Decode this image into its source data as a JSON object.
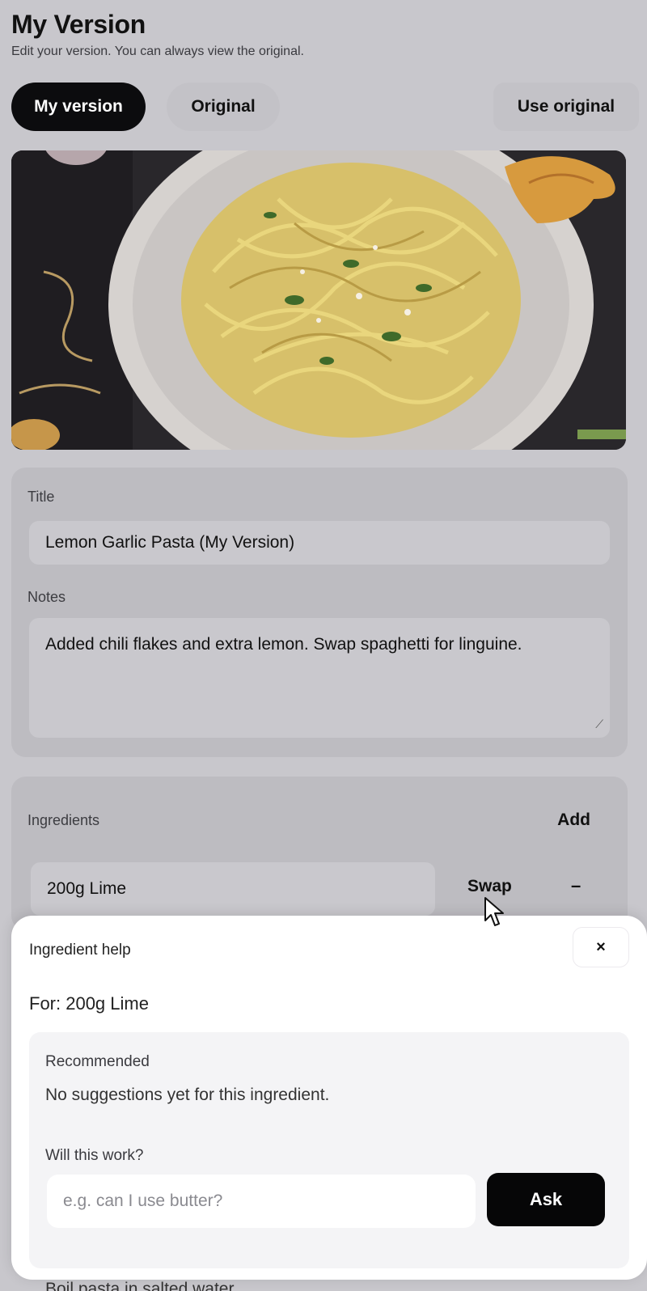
{
  "header": {
    "title": "My Version",
    "subtitle": "Edit your version. You can always view the original."
  },
  "tabs": {
    "my_version": "My version",
    "original": "Original",
    "use_original": "Use original",
    "active": "My version"
  },
  "hero": {
    "description_icon": "pasta-photo"
  },
  "form": {
    "title_label": "Title",
    "title_value": "Lemon Garlic Pasta (My Version)",
    "notes_label": "Notes",
    "notes_value": "Added chili flakes and extra lemon. Swap spaghetti for linguine."
  },
  "ingredients": {
    "label": "Ingredients",
    "add_label": "Add",
    "items": [
      {
        "name": "200g Lime",
        "swap_label": "Swap",
        "remove_label": "–"
      }
    ]
  },
  "steps": {
    "peek_text": "Boil pasta in salted water."
  },
  "ingredient_help": {
    "title": "Ingredient help",
    "close_label": "×",
    "for_text": "For: 200g Lime",
    "recommended_label": "Recommended",
    "recommended_empty": "No suggestions yet for this ingredient.",
    "question_label": "Will this work?",
    "question_placeholder": "e.g. can I use butter?",
    "ask_label": "Ask"
  },
  "colors": {
    "background": "#c8c7cc",
    "card": "#bdbcc1",
    "primary": "#0c0c0e",
    "sheet": "#ffffff"
  }
}
